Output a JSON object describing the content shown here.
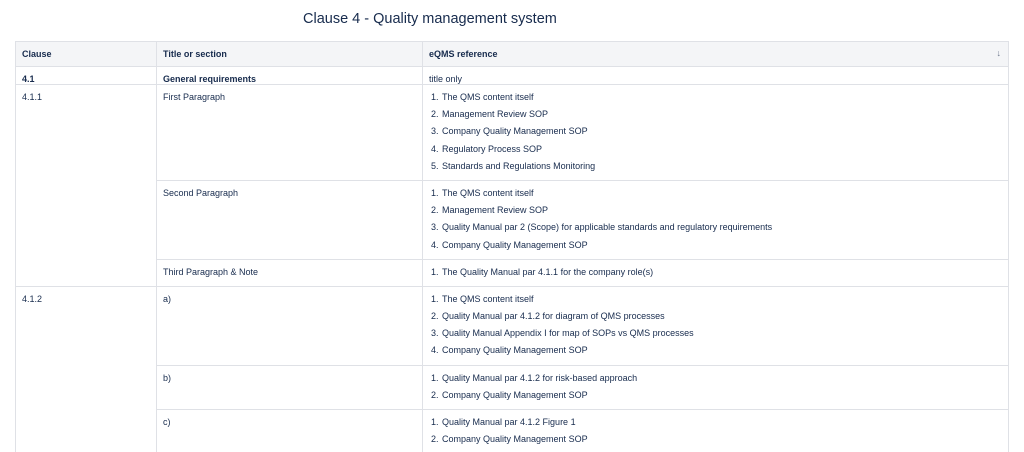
{
  "page": {
    "title": "Clause 4 - Quality management system"
  },
  "table": {
    "headers": {
      "clause": "Clause",
      "title": "Title or section",
      "reference": "eQMS reference"
    },
    "rows": [
      {
        "clause": "4.1",
        "title": "General requirements",
        "reference_text": "title only"
      },
      {
        "clause": "4.1.1",
        "title": "First Paragraph",
        "items": [
          "The QMS content itself",
          "Management Review SOP",
          "Company Quality Management SOP",
          "Regulatory Process SOP",
          "Standards and Regulations Monitoring"
        ]
      },
      {
        "title": "Second Paragraph",
        "items": [
          "The QMS content itself",
          "Management Review SOP",
          "Quality Manual par 2 (Scope) for applicable standards and regulatory requirements",
          "Company Quality Management SOP"
        ]
      },
      {
        "title": "Third Paragraph & Note",
        "items": [
          "The Quality Manual par 4.1.1 for the company role(s)"
        ]
      },
      {
        "clause": "4.1.2",
        "title": "a)",
        "items": [
          "The QMS content itself",
          "Quality Manual par 4.1.2 for diagram of QMS processes",
          "Quality Manual Appendix I for map of SOPs vs QMS processes",
          "Company Quality Management SOP"
        ]
      },
      {
        "title": "b)",
        "items": [
          "Quality Manual par 4.1.2 for risk-based approach",
          "Company Quality Management SOP"
        ]
      },
      {
        "title": "c)",
        "items": [
          "Quality Manual par 4.1.2 Figure 1",
          "Company Quality Management SOP"
        ]
      }
    ]
  }
}
